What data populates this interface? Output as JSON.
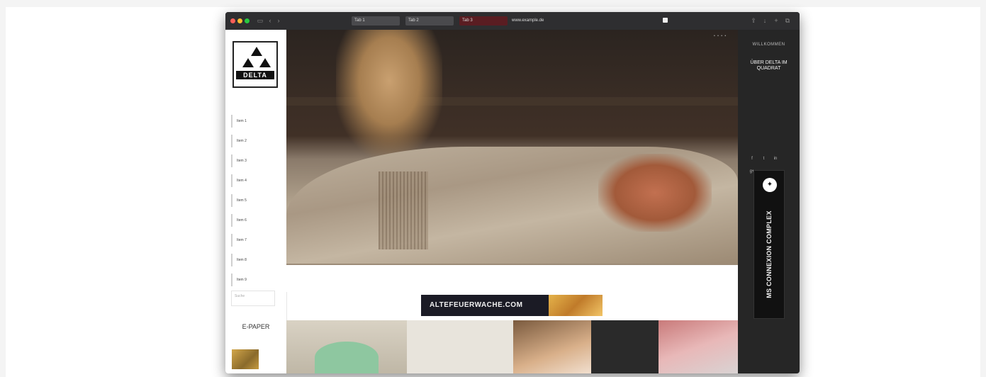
{
  "browser": {
    "tabs": [
      "Tab 1",
      "Tab 2",
      "Tab 3"
    ],
    "address": "www.example.de",
    "icons": [
      "sidebar-icon",
      "back-icon",
      "forward-icon",
      "share-icon",
      "new-tab-icon",
      "downloads-icon",
      "tabs-icon"
    ]
  },
  "logo": {
    "name": "DELTA"
  },
  "nav": {
    "items": [
      "Item 1",
      "Item 2",
      "Item 3",
      "Item 4",
      "Item 5",
      "Item 6",
      "Item 7",
      "Item 8",
      "Item 9"
    ]
  },
  "search": {
    "placeholder": "Suche"
  },
  "epaper": {
    "title": "E-PAPER"
  },
  "hero": {
    "image": "mummy-sarcophagus-photo",
    "pager": "• • • •"
  },
  "story": {
    "title": "",
    "text": ""
  },
  "banner": {
    "text": "ALTEFEUERWACHE.COM"
  },
  "right": {
    "welcome": "WILLKOMMEN",
    "title": "ÜBER DELTA IM QUADRAT",
    "text": "",
    "social": [
      "f",
      "t",
      "in",
      "g+"
    ],
    "ad_text": "MS CONNEXION COMPLEX",
    "footer": ""
  },
  "statusbar": {
    "text": ""
  },
  "colors": {
    "accent": "#c99a2e",
    "dark": "#262626"
  }
}
